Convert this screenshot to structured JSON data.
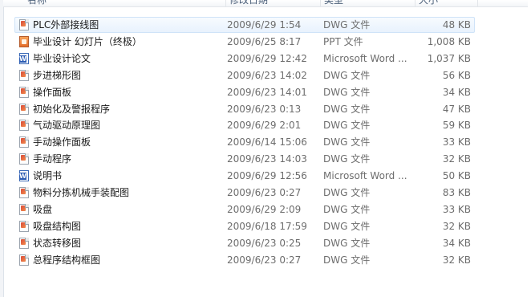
{
  "columns": {
    "name": "名称",
    "date": "修改日期",
    "type": "类型",
    "size": "大小"
  },
  "files": [
    {
      "name": "PLC外部接线图",
      "date": "2009/6/29 1:54",
      "type": "DWG 文件",
      "size": "48 KB",
      "icon": "dwg-file-icon",
      "selected": true
    },
    {
      "name": "毕业设计 幻灯片（终极）",
      "date": "2009/6/25 8:17",
      "type": "PPT 文件",
      "size": "1,008 KB",
      "icon": "ppt-file-icon"
    },
    {
      "name": "毕业设计论文",
      "date": "2009/6/29 12:42",
      "type": "Microsoft Word ...",
      "size": "1,037 KB",
      "icon": "word-file-icon"
    },
    {
      "name": "步进梯形图",
      "date": "2009/6/23 14:02",
      "type": "DWG 文件",
      "size": "56 KB",
      "icon": "dwg-file-icon"
    },
    {
      "name": "操作面板",
      "date": "2009/6/23 14:01",
      "type": "DWG 文件",
      "size": "34 KB",
      "icon": "dwg-file-icon"
    },
    {
      "name": "初始化及警报程序",
      "date": "2009/6/23 0:13",
      "type": "DWG 文件",
      "size": "47 KB",
      "icon": "dwg-file-icon"
    },
    {
      "name": "气动驱动原理图",
      "date": "2009/6/29 2:01",
      "type": "DWG 文件",
      "size": "59 KB",
      "icon": "dwg-file-icon"
    },
    {
      "name": "手动操作面板",
      "date": "2009/6/14 15:06",
      "type": "DWG 文件",
      "size": "33 KB",
      "icon": "dwg-file-icon"
    },
    {
      "name": "手动程序",
      "date": "2009/6/23 14:03",
      "type": "DWG 文件",
      "size": "32 KB",
      "icon": "dwg-file-icon"
    },
    {
      "name": "说明书",
      "date": "2009/6/29 12:56",
      "type": "Microsoft Word ...",
      "size": "50 KB",
      "icon": "word-file-icon"
    },
    {
      "name": "物料分拣机械手装配图",
      "date": "2009/6/23 0:27",
      "type": "DWG 文件",
      "size": "83 KB",
      "icon": "dwg-file-icon"
    },
    {
      "name": "吸盘",
      "date": "2009/6/29 2:09",
      "type": "DWG 文件",
      "size": "33 KB",
      "icon": "dwg-file-icon"
    },
    {
      "name": "吸盘结构图",
      "date": "2009/6/18 17:59",
      "type": "DWG 文件",
      "size": "32 KB",
      "icon": "dwg-file-icon"
    },
    {
      "name": "状态转移图",
      "date": "2009/6/23 0:25",
      "type": "DWG 文件",
      "size": "34 KB",
      "icon": "dwg-file-icon"
    },
    {
      "name": "总程序结构框图",
      "date": "2009/6/23 0:27",
      "type": "DWG 文件",
      "size": "32 KB",
      "icon": "dwg-file-icon"
    }
  ],
  "colors": {
    "selection_fill": "#e8f2fd",
    "selection_border": "#cfe3f8",
    "header_text": "#4c607a",
    "secondary_text": "#6d6d6d"
  }
}
